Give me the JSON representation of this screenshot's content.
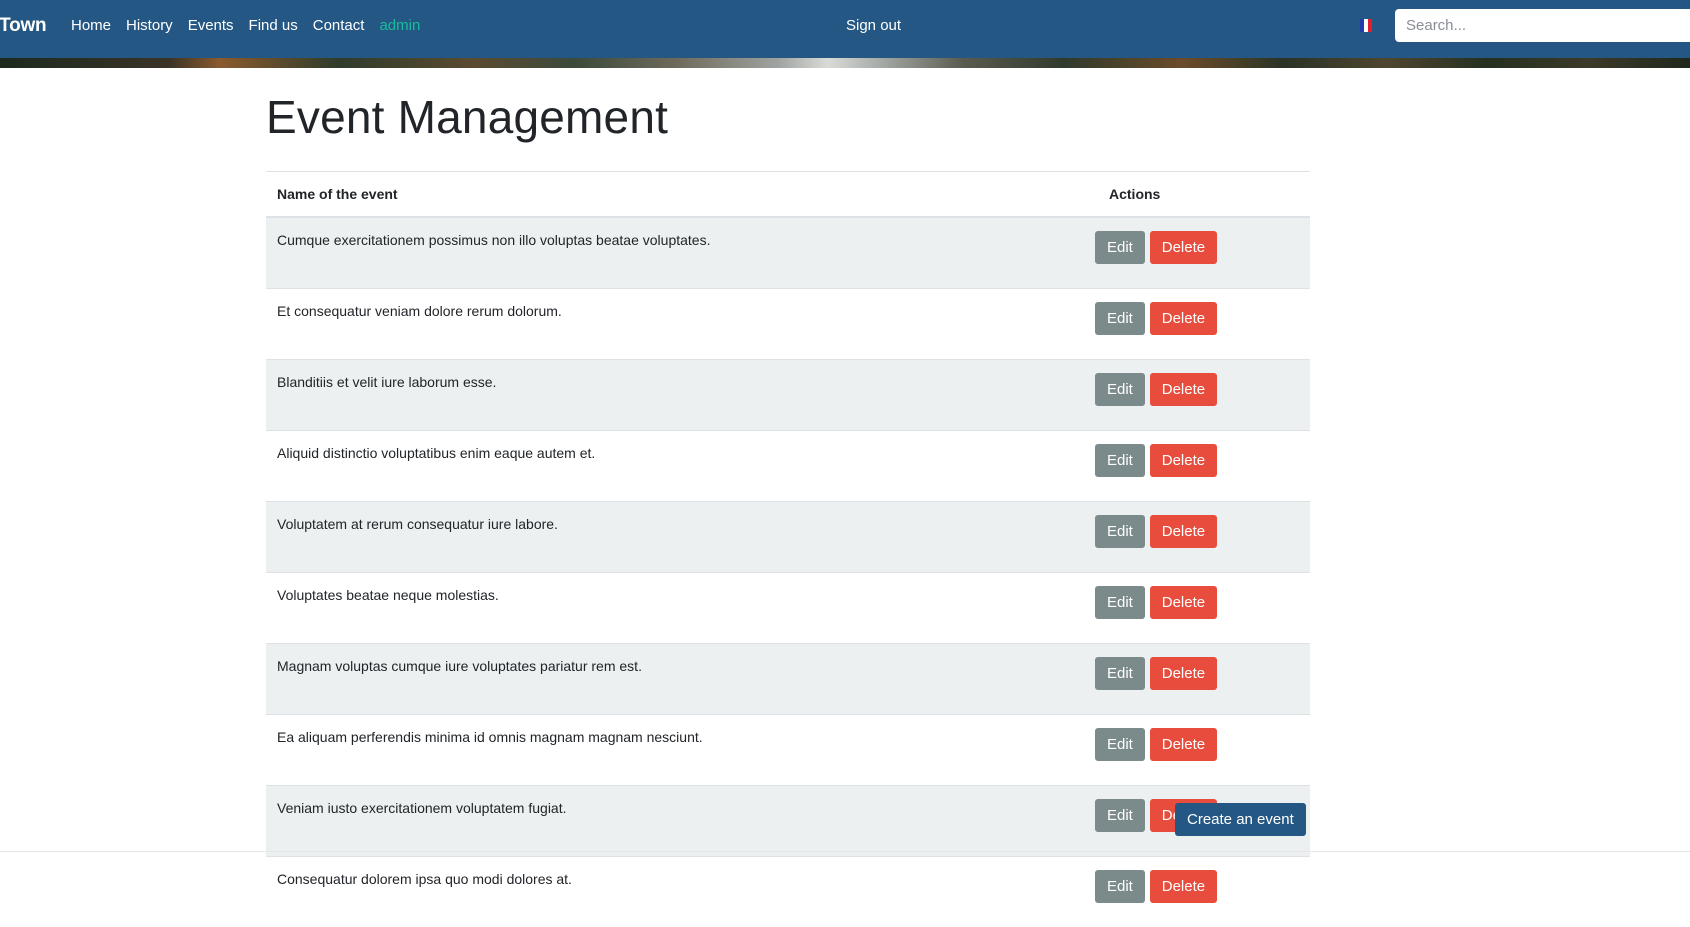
{
  "navbar": {
    "brand": "lTown",
    "links": [
      {
        "label": "Home"
      },
      {
        "label": "History"
      },
      {
        "label": "Events"
      },
      {
        "label": "Find us"
      },
      {
        "label": "Contact"
      },
      {
        "label": "admin"
      }
    ],
    "signout_label": "Sign out",
    "search_placeholder": "Search...",
    "colors": {
      "background": "#245784",
      "active_link": "#18bc9c"
    },
    "language_flag": "france-flag-icon"
  },
  "main": {
    "title": "Event Management",
    "table": {
      "columns": [
        "Name of the event",
        "Actions"
      ],
      "rows": [
        {
          "name": "Cumque exercitationem possimus non illo voluptas beatae voluptates."
        },
        {
          "name": "Et consequatur veniam dolore rerum dolorum."
        },
        {
          "name": "Blanditiis et velit iure laborum esse."
        },
        {
          "name": "Aliquid distinctio voluptatibus enim eaque autem et."
        },
        {
          "name": "Voluptatem at rerum consequatur iure labore."
        },
        {
          "name": "Voluptates beatae neque molestias."
        },
        {
          "name": "Magnam voluptas cumque iure voluptates pariatur rem est."
        },
        {
          "name": "Ea aliquam perferendis minima id omnis magnam magnam nesciunt."
        },
        {
          "name": "Veniam iusto exercitationem voluptatem fugiat."
        },
        {
          "name": "Consequatur dolorem ipsa quo modi dolores at."
        }
      ],
      "edit_label": "Edit",
      "delete_label": "Delete"
    },
    "create_label": "Create an event",
    "colors": {
      "edit": "#7b8a8b",
      "delete": "#e74c3c",
      "create": "#245784",
      "stripe": "#ecf0f1"
    }
  }
}
